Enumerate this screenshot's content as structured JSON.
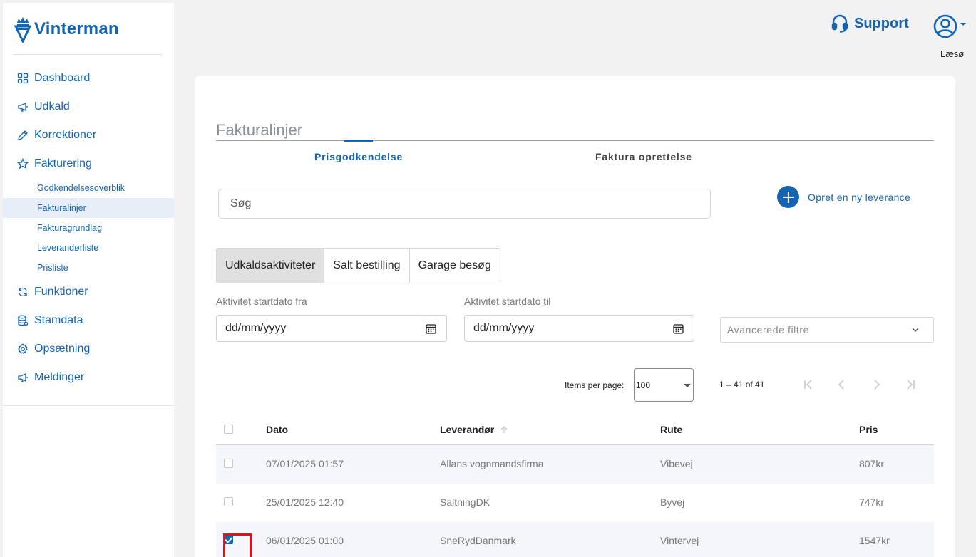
{
  "app": {
    "name": "Vinterman"
  },
  "sidebar": {
    "items": [
      {
        "label": "Dashboard",
        "icon": "dashboard-icon"
      },
      {
        "label": "Udkald",
        "icon": "megaphone-icon"
      },
      {
        "label": "Korrektioner",
        "icon": "pencil-icon"
      },
      {
        "label": "Fakturering",
        "icon": "star-icon"
      }
    ],
    "sub_items": [
      {
        "label": "Godkendelsesoverblik"
      },
      {
        "label": "Fakturalinjer",
        "active": true
      },
      {
        "label": "Fakturagrundlag"
      },
      {
        "label": "Leverandørliste"
      },
      {
        "label": "Prisliste"
      }
    ],
    "items_after": [
      {
        "label": "Funktioner",
        "icon": "refresh-icon"
      },
      {
        "label": "Stamdata",
        "icon": "database-icon"
      },
      {
        "label": "Opsætning",
        "icon": "gear-icon"
      },
      {
        "label": "Meldinger",
        "icon": "megaphone-icon"
      }
    ]
  },
  "header": {
    "support_label": "Support",
    "user_name": "Læsø"
  },
  "main": {
    "title": "Fakturalinjer",
    "tabs": [
      {
        "label": "Prisgodkendelse",
        "active": true
      },
      {
        "label": "Faktura oprettelse"
      }
    ],
    "search_placeholder": "Søg",
    "new_delivery_label": "Opret en ny leverance",
    "segments": [
      {
        "label": "Udkaldsaktiviteter",
        "active": true
      },
      {
        "label": "Salt bestilling"
      },
      {
        "label": "Garage besøg"
      }
    ],
    "date_from": {
      "label": "Aktivitet startdato fra",
      "placeholder": "dd/mm/yyyy"
    },
    "date_to": {
      "label": "Aktivitet startdato til",
      "placeholder": "dd/mm/yyyy"
    },
    "advanced_filters_label": "Avancerede filtre",
    "pagination": {
      "items_per_page_label": "Items per page:",
      "items_per_page": "100",
      "range": "1 – 41 of 41"
    },
    "table": {
      "columns": [
        "Dato",
        "Leverandør",
        "Rute",
        "Pris"
      ],
      "rows": [
        {
          "date": "07/01/2025 01:57",
          "supplier": "Allans vognmandsfirma",
          "route": "Vibevej",
          "price": "807kr",
          "checked": false
        },
        {
          "date": "25/01/2025 12:40",
          "supplier": "SaltningDK",
          "route": "Byvej",
          "price": "747kr",
          "checked": false
        },
        {
          "date": "06/01/2025 01:00",
          "supplier": "SneRydDanmark",
          "route": "Vintervej",
          "price": "1547kr",
          "checked": true
        }
      ]
    }
  },
  "colors": {
    "brand": "#1464b4",
    "highlight": "#e0121c"
  }
}
